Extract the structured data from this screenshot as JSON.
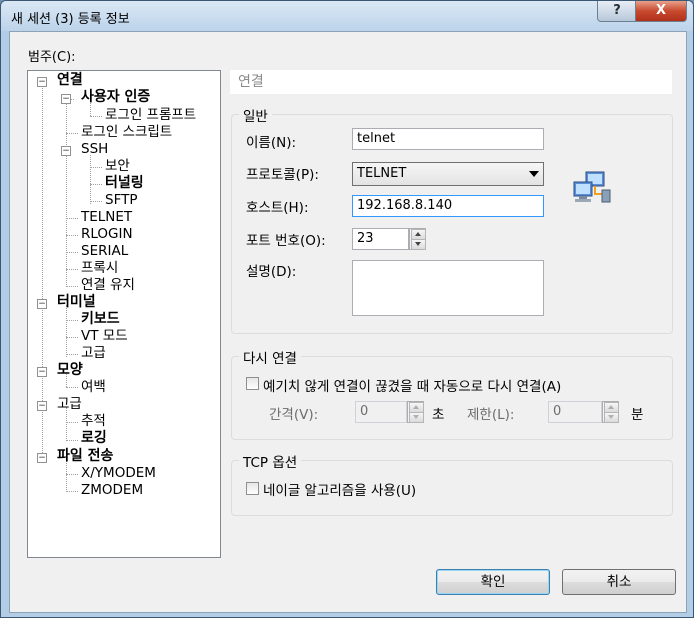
{
  "window": {
    "title": "새 세션 (3) 등록 정보",
    "help_label": "?",
    "close_label": "X"
  },
  "category_label": "범주(C):",
  "tree": {
    "nodes": [
      {
        "label": "연결",
        "bold": true
      },
      {
        "label": "사용자 인증",
        "bold": true
      },
      {
        "label": "로그인 프롬프트",
        "bold": false
      },
      {
        "label": "로그인 스크립트",
        "bold": false
      },
      {
        "label": "SSH",
        "bold": false
      },
      {
        "label": "보안",
        "bold": false
      },
      {
        "label": "터널링",
        "bold": true
      },
      {
        "label": "SFTP",
        "bold": false
      },
      {
        "label": "TELNET",
        "bold": false
      },
      {
        "label": "RLOGIN",
        "bold": false
      },
      {
        "label": "SERIAL",
        "bold": false
      },
      {
        "label": "프록시",
        "bold": false
      },
      {
        "label": "연결 유지",
        "bold": false
      },
      {
        "label": "터미널",
        "bold": true
      },
      {
        "label": "키보드",
        "bold": true
      },
      {
        "label": "VT 모드",
        "bold": false
      },
      {
        "label": "고급",
        "bold": false
      },
      {
        "label": "모양",
        "bold": true
      },
      {
        "label": "여백",
        "bold": false
      },
      {
        "label": "고급",
        "bold": false
      },
      {
        "label": "추적",
        "bold": false
      },
      {
        "label": "로깅",
        "bold": true
      },
      {
        "label": "파일 전송",
        "bold": true
      },
      {
        "label": "X/YMODEM",
        "bold": false
      },
      {
        "label": "ZMODEM",
        "bold": false
      }
    ]
  },
  "panel_title": "연결",
  "general": {
    "title": "일반",
    "name_label": "이름(N):",
    "name_value": "telnet",
    "protocol_label": "프로토콜(P):",
    "protocol_value": "TELNET",
    "host_label": "호스트(H):",
    "host_value": "192.168.8.140",
    "port_label": "포트 번호(O):",
    "port_value": "23",
    "desc_label": "설명(D):",
    "desc_value": ""
  },
  "reconnect": {
    "title": "다시 연결",
    "checkbox_label": "예기치 않게 연결이 끊겼을 때 자동으로 다시 연결(A)",
    "interval_label": "간격(V):",
    "interval_value": "0",
    "interval_unit": "초",
    "limit_label": "제한(L):",
    "limit_value": "0",
    "limit_unit": "분"
  },
  "tcp": {
    "title": "TCP 옵션",
    "nagle_label": "네이글 알고리즘을 사용(U)"
  },
  "buttons": {
    "ok": "확인",
    "cancel": "취소"
  }
}
